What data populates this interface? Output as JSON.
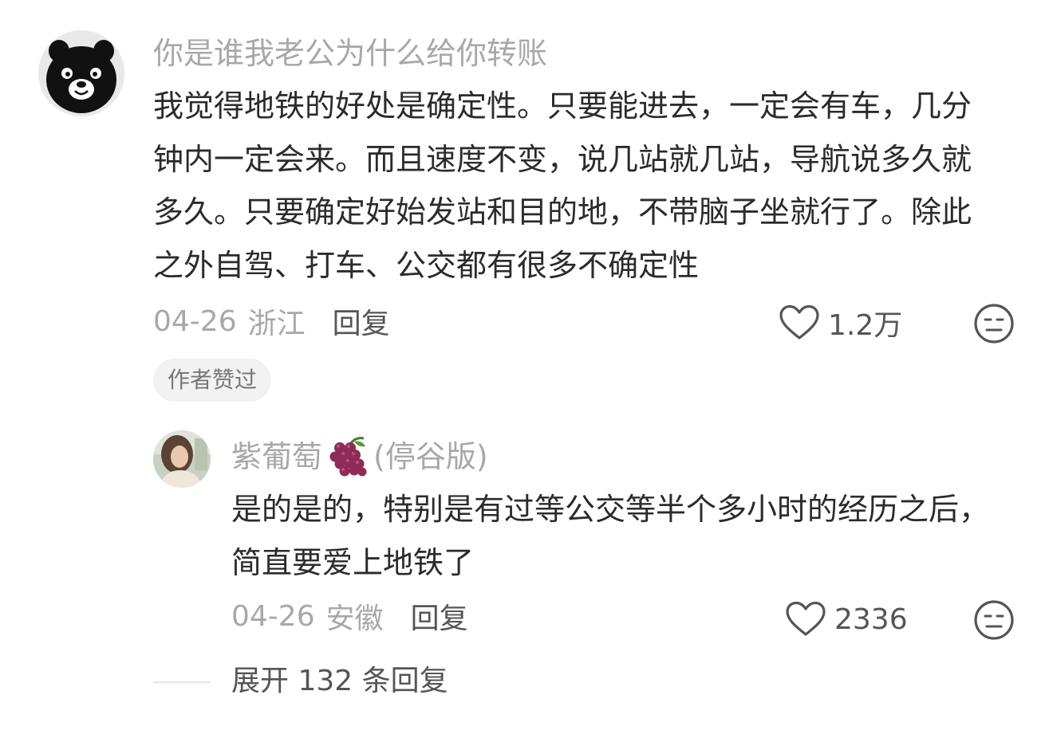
{
  "main_comment": {
    "username": "你是谁我老公为什么给你转账",
    "text": "我觉得地铁的好处是确定性。只要能进去，一定会有车，几分钟内一定会来。而且速度不变，说几站就几站，导航说多久就多久。只要确定好始发站和目的地，不带脑子坐就行了。除此之外自驾、打车、公交都有很多不确定性",
    "date": "04-26",
    "location": "浙江",
    "reply_label": "回复",
    "likes": "1.2万",
    "author_liked_badge": "作者赞过",
    "avatar_icon": "black-dog-avatar-icon",
    "like_icon": "heart-outline-icon",
    "dislike_icon": "unimpressed-face-icon"
  },
  "sub_reply": {
    "username": "紫葡萄",
    "username_suffix": "(停谷版)",
    "username_emoji": "grape-emoji-icon",
    "text": "是的是的，特别是有过等公交等半个多小时的经历之后，简直要爱上地铁了",
    "date": "04-26",
    "location": "安徽",
    "reply_label": "回复",
    "likes": "2336",
    "avatar_icon": "woman-portrait-avatar-icon",
    "like_icon": "heart-outline-icon",
    "dislike_icon": "unimpressed-face-icon"
  },
  "expand": {
    "label": "展开 132 条回复"
  },
  "colors": {
    "username": "#a8a8a8",
    "body_text": "#2b2b2b",
    "meta_text": "#a8a8a8",
    "action_text": "#555555",
    "badge_bg": "#f2f2f2",
    "grape": "#8e2b56"
  }
}
